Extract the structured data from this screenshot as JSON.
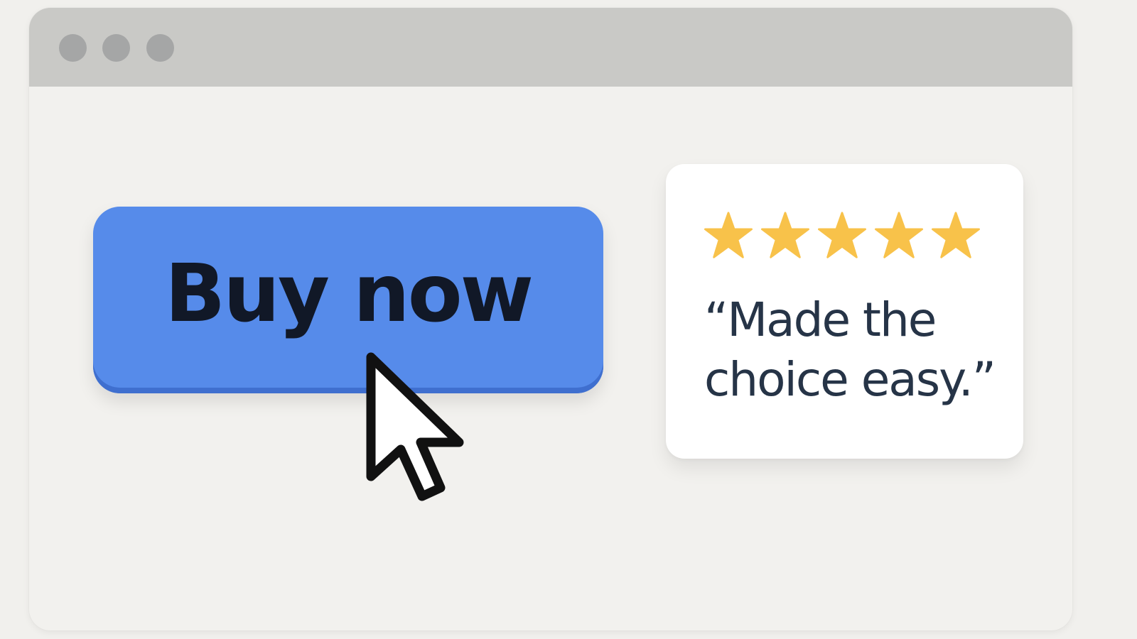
{
  "window": {
    "controls": [
      "window-dot",
      "window-dot",
      "window-dot"
    ]
  },
  "main": {
    "buy_button": {
      "label": "Buy now"
    },
    "review": {
      "rating": 5,
      "rating_max": 5,
      "quote": "“Made the choice easy.”"
    }
  },
  "colors": {
    "background": "#f1f0ed",
    "titlebar": "#c9c9c6",
    "window_dot": "#a5a6a6",
    "button_fill": "#568bea",
    "button_text": "#111827",
    "star": "#f8c24a",
    "quote_text": "#263447"
  },
  "icons": {
    "star": "star-icon",
    "cursor": "mouse-pointer-icon"
  }
}
